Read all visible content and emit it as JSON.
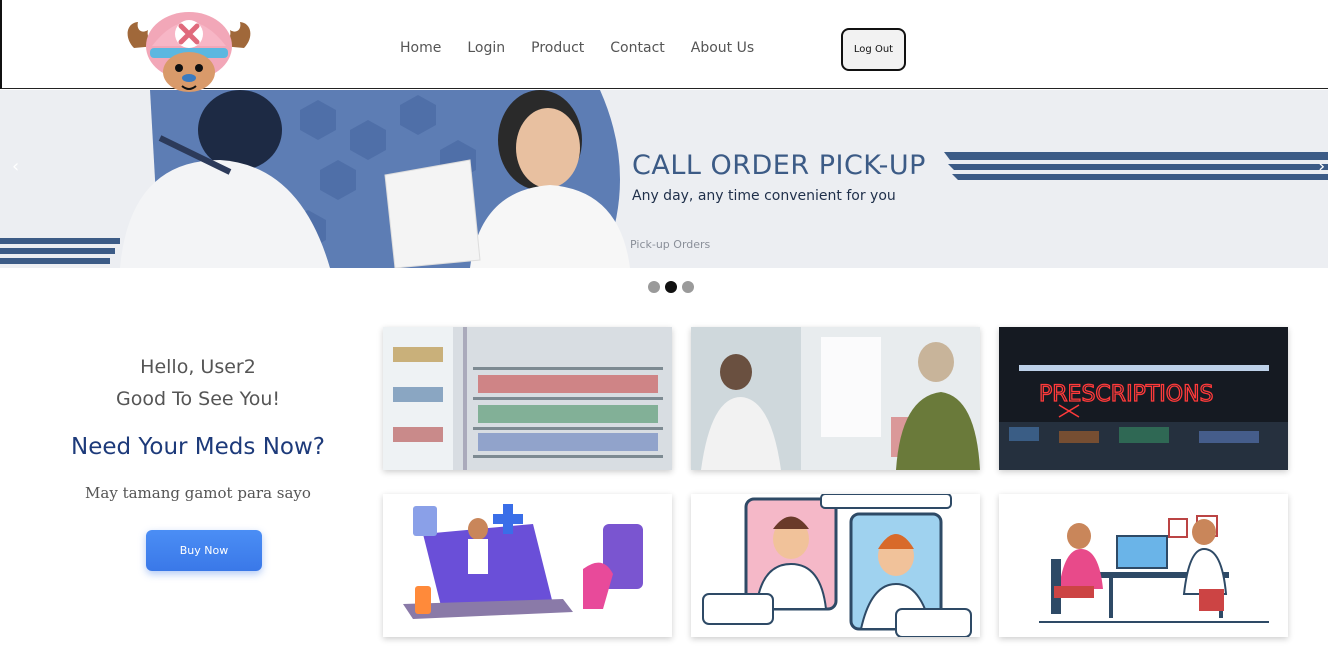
{
  "header": {
    "logo_icon": "chopper-mascot-logo",
    "nav": [
      {
        "label": "Home"
      },
      {
        "label": "Login"
      },
      {
        "label": "Product"
      },
      {
        "label": "Contact"
      },
      {
        "label": "About Us"
      }
    ],
    "logout_label": "Log Out"
  },
  "carousel": {
    "title": "CALL ORDER PICK-UP",
    "subtitle": "Any day, any time convenient for you",
    "caption": "Pick-up Orders",
    "prev_icon": "chevron-left-icon",
    "next_icon": "chevron-right-icon",
    "slide_count": 3,
    "active_slide": 2,
    "prev_glyph": "‹",
    "next_glyph": "›"
  },
  "promo": {
    "greeting_line1": "Hello, User2",
    "greeting_line2": "Good To See You!",
    "headline": "Need Your Meds Now?",
    "tagline": "May tamang gamot para sayo",
    "button_label": "Buy Now"
  },
  "gallery": [
    {
      "icon": "pharmacy-shelves-photo"
    },
    {
      "icon": "pharmacist-counter-photo"
    },
    {
      "icon": "prescriptions-neon-sign-photo"
    },
    {
      "icon": "online-pharmacy-laptop-illustration"
    },
    {
      "icon": "telemedicine-video-call-illustration"
    },
    {
      "icon": "doctor-consultation-illustration"
    }
  ],
  "colors": {
    "brand_blue": "#3c5b86",
    "headline_blue": "#1d3a7a",
    "button_blue": "#3a78e8"
  }
}
